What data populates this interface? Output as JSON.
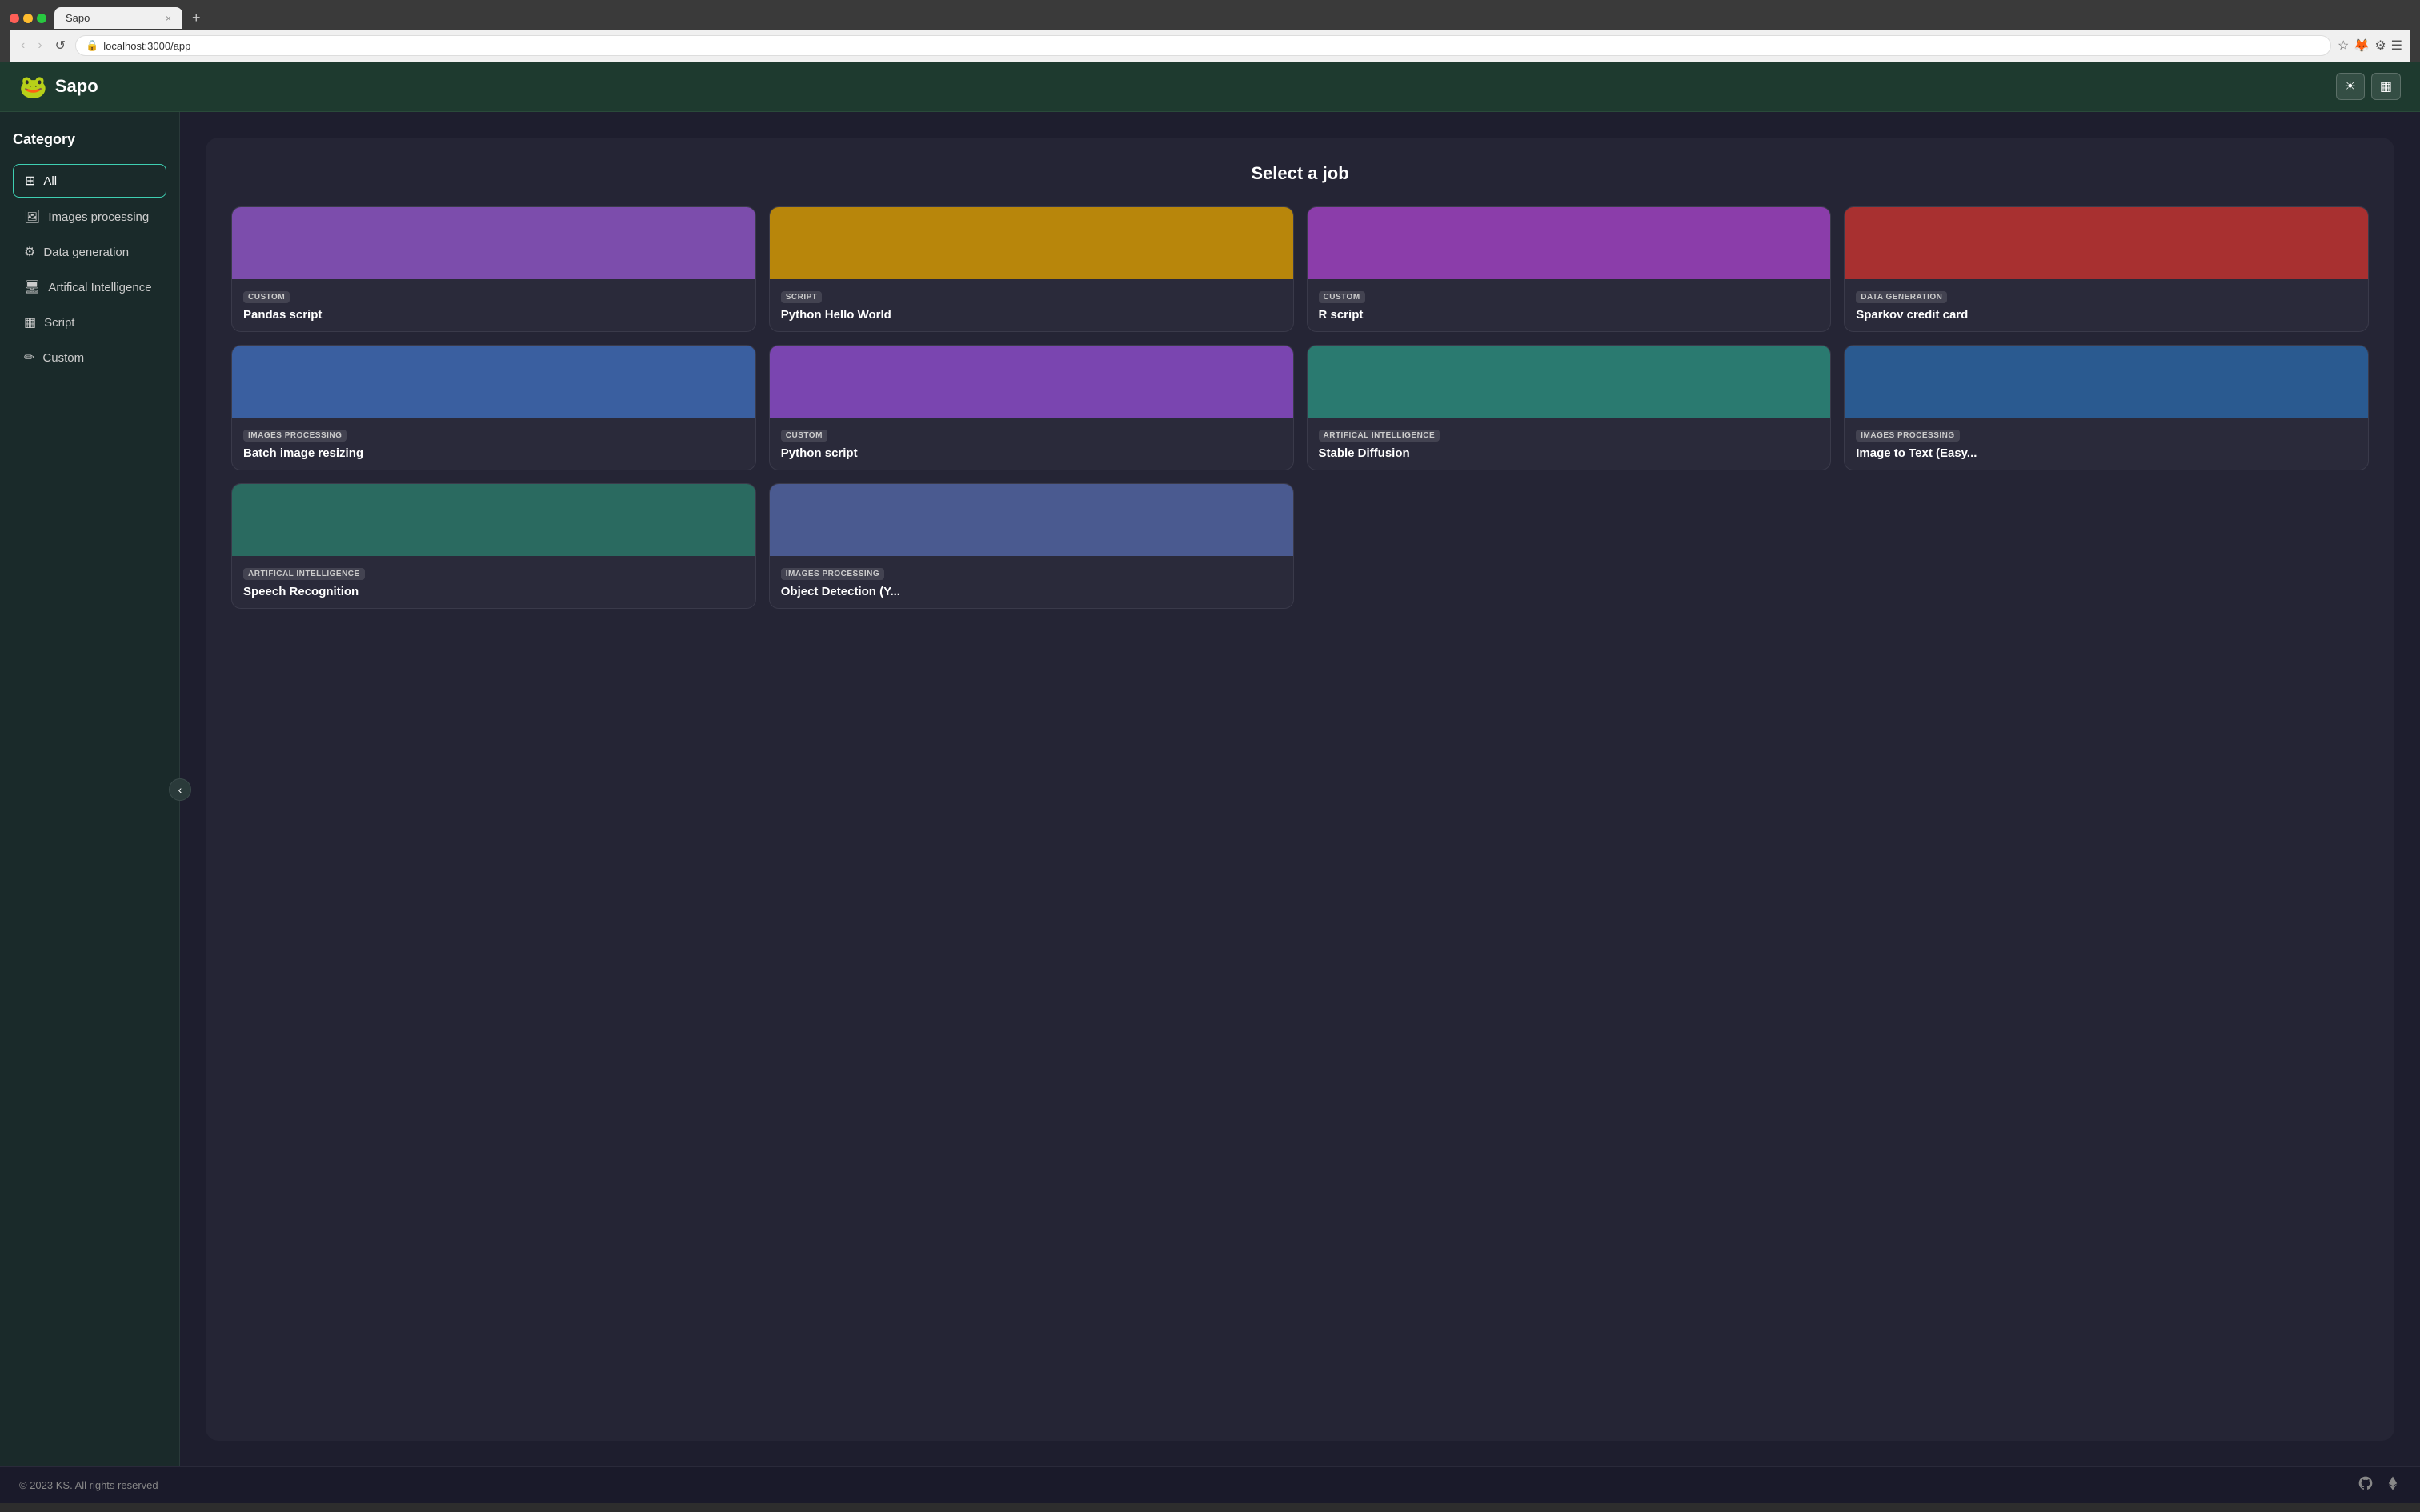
{
  "browser": {
    "tab_title": "Sapo",
    "tab_close": "×",
    "tab_add": "+",
    "url": "localhost:3000/app",
    "nav_back": "‹",
    "nav_forward": "›",
    "nav_reload": "↺"
  },
  "app": {
    "logo_emoji": "🐸",
    "logo_text": "Sapo",
    "header_theme_icon": "☀",
    "header_grid_icon": "▦"
  },
  "sidebar": {
    "title": "Category",
    "items": [
      {
        "id": "all",
        "label": "All",
        "icon": "⊞",
        "active": true
      },
      {
        "id": "images-processing",
        "label": "Images processing",
        "icon": "🖼",
        "active": false
      },
      {
        "id": "data-generation",
        "label": "Data generation",
        "icon": "⚙",
        "active": false
      },
      {
        "id": "artificial-intelligence",
        "label": "Artifical Intelligence",
        "icon": "🖥",
        "active": false
      },
      {
        "id": "script",
        "label": "Script",
        "icon": "▦",
        "active": false
      },
      {
        "id": "custom",
        "label": "Custom",
        "icon": "✏",
        "active": false
      }
    ],
    "collapse_icon": "‹"
  },
  "main": {
    "page_title": "Select a job",
    "jobs": [
      {
        "id": 1,
        "badge": "CUSTOM",
        "title": "Pandas script",
        "color": "bg-purple"
      },
      {
        "id": 2,
        "badge": "SCRIPT",
        "title": "Python Hello World",
        "color": "bg-amber"
      },
      {
        "id": 3,
        "badge": "CUSTOM",
        "title": "R script",
        "color": "bg-purple2"
      },
      {
        "id": 4,
        "badge": "DATA GENERATION",
        "title": "Sparkov credit card",
        "color": "bg-red"
      },
      {
        "id": 5,
        "badge": "IMAGES PROCESSING",
        "title": "Batch image resizing",
        "color": "bg-blue"
      },
      {
        "id": 6,
        "badge": "CUSTOM",
        "title": "Python script",
        "color": "bg-purple3"
      },
      {
        "id": 7,
        "badge": "ARTIFICAL INTELLIGENCE",
        "title": "Stable Diffusion",
        "color": "bg-teal"
      },
      {
        "id": 8,
        "badge": "IMAGES PROCESSING",
        "title": "Image to Text (Easy...",
        "color": "bg-blue2"
      },
      {
        "id": 9,
        "badge": "ARTIFICAL INTELLIGENCE",
        "title": "Speech Recognition",
        "color": "bg-teal2"
      },
      {
        "id": 10,
        "badge": "IMAGES PROCESSING",
        "title": "Object Detection (Y...",
        "color": "bg-blue3"
      }
    ]
  },
  "footer": {
    "copyright": "© 2023 KS. All rights reserved",
    "github_icon": "⌘",
    "eth_icon": "◆"
  }
}
